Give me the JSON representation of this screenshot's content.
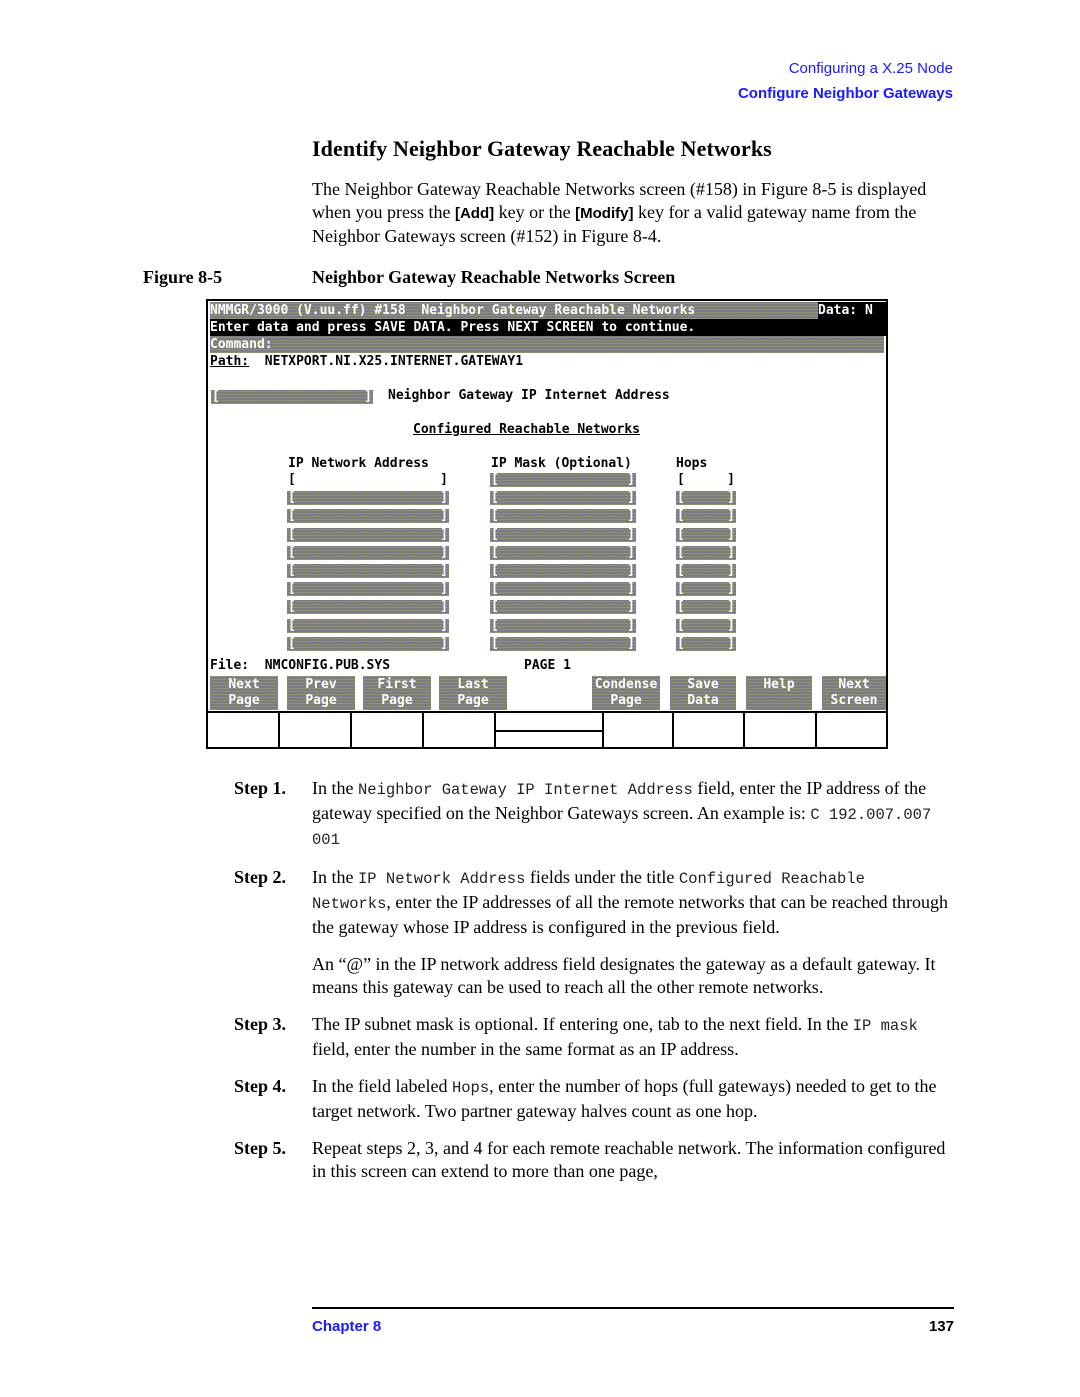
{
  "running_head": {
    "chapter_title": "Configuring a X.25 Node",
    "section_title": "Configure Neighbor Gateways"
  },
  "section": {
    "title": "Identify Neighbor Gateway Reachable Networks",
    "intro": {
      "part1": "The Neighbor Gateway Reachable Networks screen (#158) in Figure 8-5 is displayed when you press the ",
      "key_add": "[Add]",
      "part2": " key or the ",
      "key_modify": "[Modify]",
      "part3": " key for a valid gateway name from the Neighbor Gateways screen (#152) in Figure 8-4."
    }
  },
  "figure": {
    "label": "Figure 8-5",
    "title": "Neighbor Gateway Reachable Networks Screen"
  },
  "terminal": {
    "header": "NMMGR/3000 (V.uu.ff) #158  Neighbor Gateway Reachable Networks",
    "data_flag": "Data: N",
    "instruction": "Enter data and press SAVE DATA. Press NEXT SCREEN to continue.",
    "command_label": "Command:",
    "path_label": "Path:",
    "path_value": "NETXPORT.NI.X25.INTERNET.GATEWAY1",
    "gateway_ip_label": "Neighbor Gateway IP Internet Address",
    "configured_title": "Configured Reachable Networks",
    "columns": {
      "ip_network": "IP Network Address",
      "ip_mask": "IP Mask (Optional)",
      "hops": "Hops"
    },
    "rows": [
      {
        "ip_network": "",
        "ip_mask": "",
        "hops": ""
      },
      {
        "ip_network": "",
        "ip_mask": "",
        "hops": ""
      },
      {
        "ip_network": "",
        "ip_mask": "",
        "hops": ""
      },
      {
        "ip_network": "",
        "ip_mask": "",
        "hops": ""
      },
      {
        "ip_network": "",
        "ip_mask": "",
        "hops": ""
      },
      {
        "ip_network": "",
        "ip_mask": "",
        "hops": ""
      },
      {
        "ip_network": "",
        "ip_mask": "",
        "hops": ""
      },
      {
        "ip_network": "",
        "ip_mask": "",
        "hops": ""
      },
      {
        "ip_network": "",
        "ip_mask": "",
        "hops": ""
      },
      {
        "ip_network": "",
        "ip_mask": "",
        "hops": ""
      }
    ],
    "file_label": "File:",
    "file_value": "NMCONFIG.PUB.SYS",
    "page_label": "PAGE 1",
    "softkeys": [
      {
        "line1": "Next",
        "line2": "Page"
      },
      {
        "line1": "Prev",
        "line2": "Page"
      },
      {
        "line1": "First",
        "line2": "Page"
      },
      {
        "line1": "Last",
        "line2": "Page"
      },
      {
        "line1": "Condense",
        "line2": "Page"
      },
      {
        "line1": "Save",
        "line2": "Data"
      },
      {
        "line1": "Help",
        "line2": ""
      },
      {
        "line1": "Next",
        "line2": "Screen"
      }
    ]
  },
  "steps": [
    {
      "label": "Step 1.",
      "t1": "In the ",
      "m1": "Neighbor Gateway IP Internet Address",
      "t2": " field, enter the IP address of the gateway specified on the Neighbor Gateways screen. An example is: ",
      "m2": "C 192.007.007 001",
      "t3": ""
    },
    {
      "label": "Step 2.",
      "t1": "In the ",
      "m1": "IP Network Address",
      "t2": " fields under the title ",
      "m2": "Configured Reachable Networks",
      "t3": ", enter the IP addresses of all the remote networks that can be reached through the gateway whose IP address is configured in the previous field."
    },
    {
      "label": "Step 3.",
      "t1": "The IP subnet mask is optional. If entering one, tab to the next field. In the ",
      "m1": "IP mask",
      "t2": " field, enter the number in the same format as an IP address.",
      "m2": "",
      "t3": ""
    },
    {
      "label": "Step 4.",
      "t1": "In the field labeled ",
      "m1": "Hops",
      "t2": ", enter the number of hops (full gateways) needed to get to the target network. Two partner gateway halves count as one hop.",
      "m2": "",
      "t3": ""
    },
    {
      "label": "Step 5.",
      "t1": "Repeat steps 2, 3, and 4 for each remote reachable network. The information configured in this screen can extend to more than one page,",
      "m1": "",
      "t2": "",
      "m2": "",
      "t3": ""
    }
  ],
  "step2_note": "An “@” in the IP network address field designates the gateway as a default gateway. It means this gateway can be used to reach all the other remote networks.",
  "footer": {
    "chapter": "Chapter 8",
    "page_number": "137"
  },
  "colors": {
    "link_blue": "#1a1aff",
    "terminal_dither": "#7e7d6e"
  }
}
